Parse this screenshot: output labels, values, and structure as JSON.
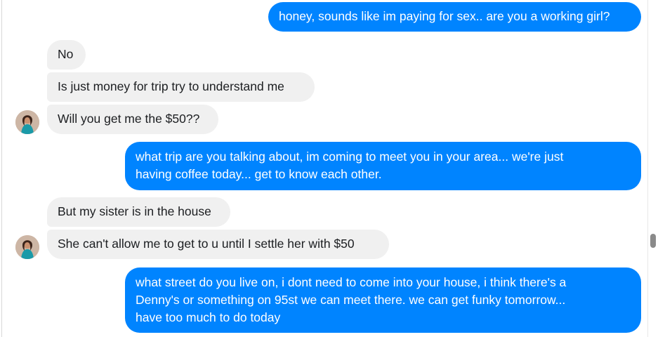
{
  "conversation": {
    "messages": [
      {
        "sender": "me",
        "text": "honey, sounds like im paying for sex.. are you a working girl?"
      },
      {
        "sender": "them",
        "text": "No"
      },
      {
        "sender": "them",
        "text": "Is just money for trip try to understand me"
      },
      {
        "sender": "them",
        "text": "Will you get me the $50??"
      },
      {
        "sender": "me",
        "lines": [
          "what trip are you talking about, im coming to meet you in your area...  we're just",
          "having coffee today...  get to know each other."
        ]
      },
      {
        "sender": "them",
        "text": "But my sister is in the house"
      },
      {
        "sender": "them",
        "text": "She can't allow me to get to u until I settle her with $50"
      },
      {
        "sender": "me",
        "lines": [
          "what street do you live on,  i dont need to come into your house, i think there's a",
          "Denny's or something on 95st we can meet there.   we can get funky tomorrow...",
          "have too much to do today"
        ]
      }
    ]
  },
  "colors": {
    "outgoing_bubble": "#0084ff",
    "incoming_bubble": "#f0f0f0",
    "outgoing_text": "#ffffff",
    "incoming_text": "#1c1e21"
  },
  "icons": {
    "avatar": "contact-avatar"
  }
}
